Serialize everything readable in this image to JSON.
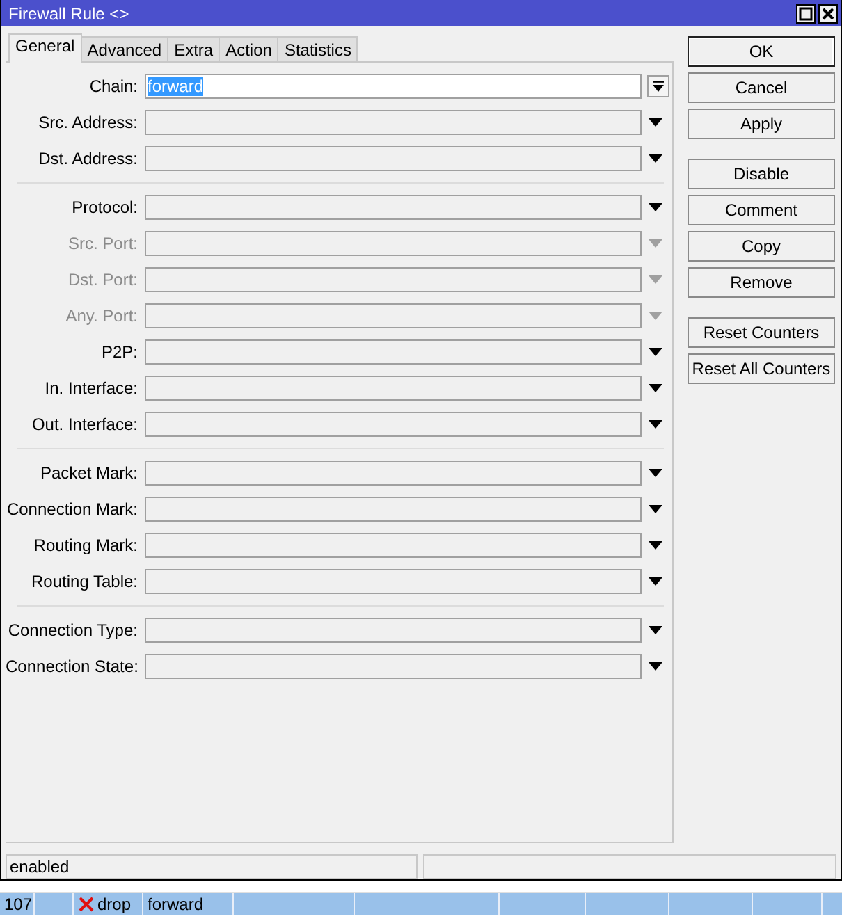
{
  "window": {
    "title": "Firewall Rule <>"
  },
  "tabs": [
    {
      "label": "General",
      "selected": true
    },
    {
      "label": "Advanced",
      "selected": false
    },
    {
      "label": "Extra",
      "selected": false
    },
    {
      "label": "Action",
      "selected": false
    },
    {
      "label": "Statistics",
      "selected": false
    }
  ],
  "field_groups": [
    {
      "fields": [
        {
          "label": "Chain:",
          "kind": "combo",
          "value": "forward",
          "highlighted": true,
          "disabled": false
        },
        {
          "label": "Src. Address:",
          "kind": "dropdown",
          "disabled": false
        },
        {
          "label": "Dst. Address:",
          "kind": "dropdown",
          "disabled": false
        }
      ]
    },
    {
      "fields": [
        {
          "label": "Protocol:",
          "kind": "dropdown",
          "disabled": false
        },
        {
          "label": "Src. Port:",
          "kind": "dropdown",
          "disabled": true
        },
        {
          "label": "Dst. Port:",
          "kind": "dropdown",
          "disabled": true
        },
        {
          "label": "Any. Port:",
          "kind": "dropdown",
          "disabled": true
        },
        {
          "label": "P2P:",
          "kind": "dropdown",
          "disabled": false
        },
        {
          "label": "In. Interface:",
          "kind": "dropdown",
          "disabled": false
        },
        {
          "label": "Out. Interface:",
          "kind": "dropdown",
          "disabled": false
        }
      ]
    },
    {
      "fields": [
        {
          "label": "Packet Mark:",
          "kind": "dropdown",
          "disabled": false
        },
        {
          "label": "Connection Mark:",
          "kind": "dropdown",
          "disabled": false
        },
        {
          "label": "Routing Mark:",
          "kind": "dropdown",
          "disabled": false
        },
        {
          "label": "Routing Table:",
          "kind": "dropdown",
          "disabled": false
        }
      ]
    },
    {
      "fields": [
        {
          "label": "Connection Type:",
          "kind": "dropdown",
          "disabled": false
        },
        {
          "label": "Connection State:",
          "kind": "dropdown",
          "disabled": false
        }
      ]
    }
  ],
  "button_groups": [
    [
      "OK",
      "Cancel",
      "Apply"
    ],
    [
      "Disable",
      "Comment",
      "Copy",
      "Remove"
    ],
    [
      "Reset Counters",
      "Reset All Counters"
    ]
  ],
  "status_bar": {
    "status": "enabled"
  },
  "background_list": {
    "row": {
      "number": "107",
      "action": "drop",
      "chain": "forward",
      "selected": true
    }
  }
}
